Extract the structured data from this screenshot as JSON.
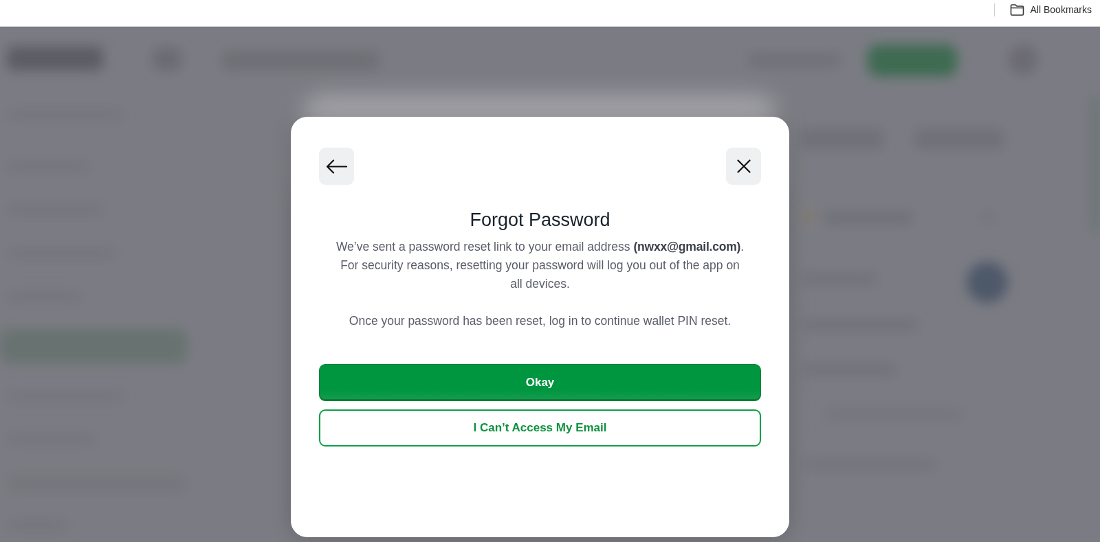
{
  "browser_bar": {
    "bookmarks": "All Bookmarks"
  },
  "dialog": {
    "title": "Forgot Password",
    "paragraphs": [
      "We’ve sent a password reset link to your email address **(nwxx@gmail.com)**. For security reasons, resetting your password will log you out of the app on all devices.",
      "Once your password has been reset, log in to continue wallet PIN reset."
    ],
    "buttons": [
      {
        "label": "Okay",
        "kind": "primary"
      },
      {
        "label": "I Can’t Access My Email",
        "kind": "outline"
      }
    ]
  }
}
